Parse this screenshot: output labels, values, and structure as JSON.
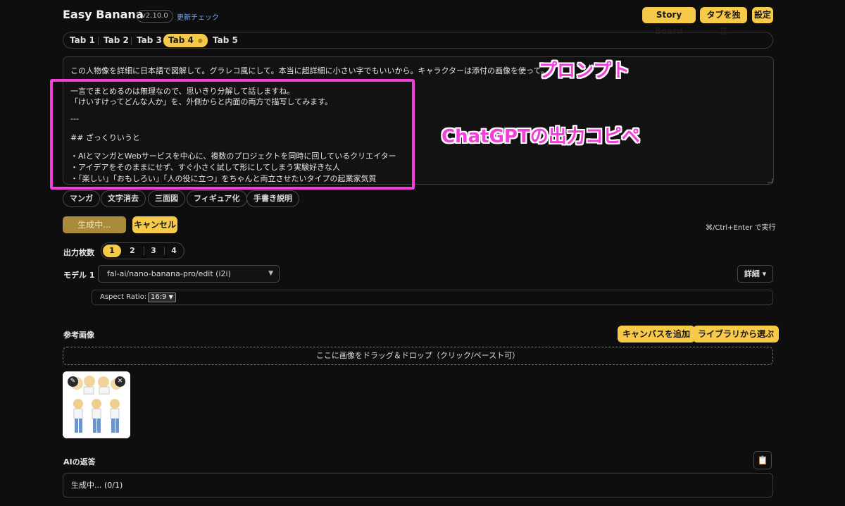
{
  "header": {
    "app_title": "Easy Banana",
    "version": "v2.10.0",
    "update_check": "更新チェック",
    "buttons": {
      "story_board": "Story Board",
      "detach_tab": "タブを独立",
      "settings": "設定"
    }
  },
  "tabs": [
    {
      "label": "Tab 1",
      "active": false
    },
    {
      "label": "Tab 2",
      "active": false
    },
    {
      "label": "Tab 3",
      "active": false
    },
    {
      "label": "Tab 4",
      "active": true,
      "indicator": "●"
    },
    {
      "label": "Tab 5",
      "active": false
    }
  ],
  "prompt": {
    "lines": [
      "この人物像を詳細に日本語で図解して。グラレコ風にして。本当に超詳細に小さい字でもいいから。キャラクターは添付の画像を使って。",
      "一言でまとめるのは無理なので、思いきり分解して話しますね。",
      "「けいすけってどんな人か」を、外側からと内面の両方で描写してみます。",
      "---",
      "## ざっくりいうと",
      "・AIとマンガとWebサービスを中心に、複数のプロジェクトを同時に回しているクリエイター",
      "・アイデアをそのままにせず、すぐ小さく試して形にしてしまう実験好きな人",
      "・「楽しい」「おもしろい」「人の役に立つ」をちゃんと両立させたいタイプの起業家気質"
    ]
  },
  "annotations": {
    "prompt": "プロンプト",
    "chatgpt": "ChatGPTの出力コピペ",
    "color": "#f23fd8"
  },
  "presets": [
    "マンガ",
    "文字消去",
    "三面図",
    "フィギュア化",
    "手書き説明"
  ],
  "generate": {
    "generating": "生成中...",
    "cancel": "キャンセル",
    "shortcut": "⌘/Ctrl+Enter で実行"
  },
  "output_count": {
    "label": "出力枚数",
    "options": [
      "1",
      "2",
      "3",
      "4"
    ],
    "selected": "1"
  },
  "model": {
    "label": "モデル 1",
    "value": "fal-ai/nano-banana-pro/edit (i2i)",
    "detail": "詳細 ▾",
    "aspect_label": "Aspect Ratio:",
    "aspect_value": "16:9"
  },
  "reference": {
    "label": "参考画像",
    "add_canvas": "キャンバスを追加",
    "choose_library": "ライブラリから選ぶ",
    "dropzone": "ここに画像をドラッグ＆ドロップ（クリック/ペースト可）",
    "thumb_icons": {
      "edit": "pencil-icon",
      "remove": "close-icon"
    }
  },
  "ai_reply": {
    "label": "AIの返答",
    "status": "生成中... (0/1)",
    "copy_icon": "clipboard-icon"
  },
  "colors": {
    "accent": "#f7c948",
    "background": "#0e0e0e",
    "generating_button": "#a98b3b"
  }
}
